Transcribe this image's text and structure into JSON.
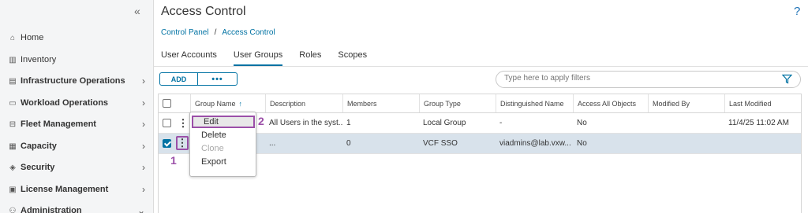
{
  "sidebar": {
    "collapse_glyph": "«",
    "items": [
      {
        "label": "Home",
        "icon": "home-icon"
      },
      {
        "label": "Inventory",
        "icon": "inventory-icon"
      },
      {
        "label": "Infrastructure Operations",
        "icon": "infrastructure-icon"
      },
      {
        "label": "Workload Operations",
        "icon": "workload-icon"
      },
      {
        "label": "Fleet Management",
        "icon": "fleet-icon"
      },
      {
        "label": "Capacity",
        "icon": "capacity-icon"
      },
      {
        "label": "Security",
        "icon": "shield-icon"
      },
      {
        "label": "License Management",
        "icon": "license-icon"
      },
      {
        "label": "Administration",
        "icon": "admin-icon"
      }
    ]
  },
  "header": {
    "title": "Access Control",
    "help": "?",
    "breadcrumb": [
      "Control Panel",
      "Access Control"
    ],
    "breadcrumb_sep": "/"
  },
  "tabs": [
    "User Accounts",
    "User Groups",
    "Roles",
    "Scopes"
  ],
  "active_tab": "User Groups",
  "toolbar": {
    "add_label": "ADD",
    "more_label": "•••"
  },
  "filter": {
    "placeholder": "Type here to apply filters",
    "icon": "funnel-icon"
  },
  "table": {
    "columns": [
      "Group Name",
      "Description",
      "Members",
      "Group Type",
      "Distinguished Name",
      "Access All Objects",
      "Modified By",
      "Last Modified"
    ],
    "sort_indicator": "↑",
    "rows": [
      {
        "selected": false,
        "group_name": "",
        "description": "All Users in the syst...",
        "members": "1",
        "group_type": "Local Group",
        "distinguished_name": "-",
        "access_all": "No",
        "modified_by": "",
        "last_modified": "11/4/25 11:02 AM"
      },
      {
        "selected": true,
        "group_name": "",
        "description": "...",
        "members": "0",
        "group_type": "VCF SSO",
        "distinguished_name": "viadmins@lab.vxw...",
        "access_all": "No",
        "modified_by": "",
        "last_modified": ""
      }
    ]
  },
  "context_menu": {
    "items": [
      {
        "label": "Edit",
        "disabled": false
      },
      {
        "label": "Delete",
        "disabled": false
      },
      {
        "label": "Clone",
        "disabled": true
      },
      {
        "label": "Export",
        "disabled": false
      }
    ]
  },
  "annotations": {
    "step1": "1",
    "step2": "2",
    "color": "#9b4fa8"
  },
  "colors": {
    "accent": "#0072a3",
    "selected_row": "#d8e2eb",
    "annotation": "#9b4fa8"
  }
}
